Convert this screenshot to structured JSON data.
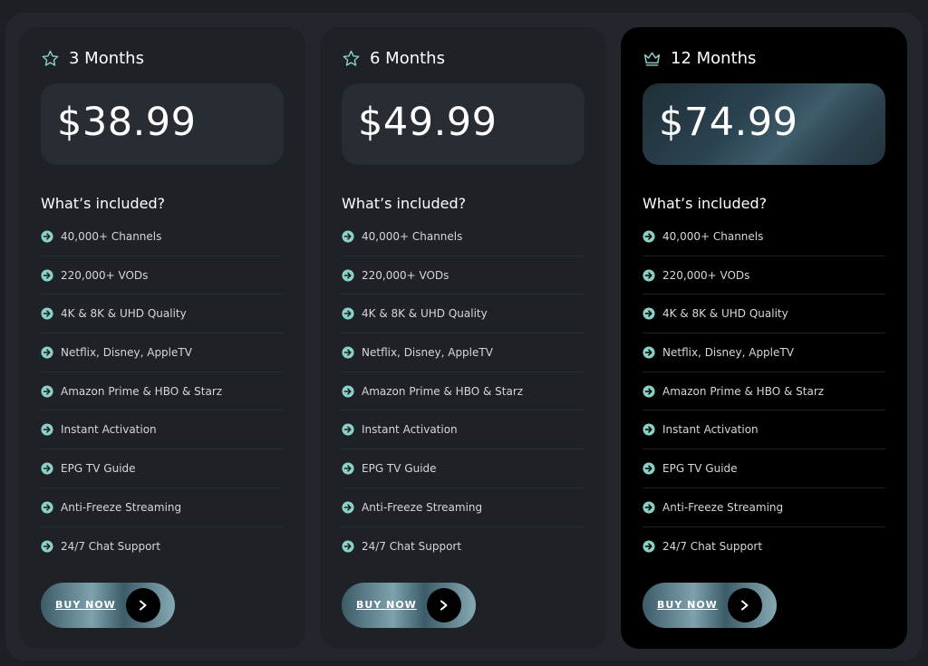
{
  "colors": {
    "page_bg": "#1c1f24",
    "card_bg": "#1e2126",
    "featured_card_bg": "#000000",
    "accent": "#8ad1c8"
  },
  "plans": [
    {
      "icon": "star-icon",
      "name": "3 Months",
      "price": "$38.99",
      "included_title": "What’s included?",
      "features": [
        "40,000+ Channels",
        "220,000+ VODs",
        "4K & 8K & UHD Quality",
        "Netflix, Disney, AppleTV",
        "Amazon Prime & HBO & Starz",
        "Instant Activation",
        "EPG TV Guide",
        "Anti-Freeze Streaming",
        "24/7 Chat Support"
      ],
      "button_label": "BUY NOW"
    },
    {
      "icon": "star-icon",
      "name": "6 Months",
      "price": "$49.99",
      "included_title": "What’s included?",
      "features": [
        "40,000+ Channels",
        "220,000+ VODs",
        "4K & 8K & UHD Quality",
        "Netflix, Disney, AppleTV",
        "Amazon Prime & HBO & Starz",
        "Instant Activation",
        "EPG TV Guide",
        "Anti-Freeze Streaming",
        "24/7 Chat Support"
      ],
      "button_label": "BUY NOW"
    },
    {
      "icon": "crown-icon",
      "name": "12 Months",
      "price": "$74.99",
      "included_title": "What’s included?",
      "features": [
        "40,000+ Channels",
        "220,000+ VODs",
        "4K & 8K & UHD Quality",
        "Netflix, Disney, AppleTV",
        "Amazon Prime & HBO & Starz",
        "Instant Activation",
        "EPG TV Guide",
        "Anti-Freeze Streaming",
        "24/7 Chat Support"
      ],
      "button_label": "BUY NOW"
    }
  ]
}
